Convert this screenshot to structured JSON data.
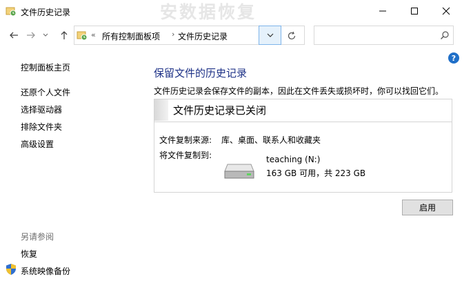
{
  "window": {
    "title": "文件历史记录",
    "watermark": "安数据恢复",
    "minimize_icon": "minimize-icon",
    "maximize_icon": "maximize-icon",
    "close_icon": "close-icon"
  },
  "nav": {
    "back_icon": "back-arrow-icon",
    "forward_icon": "forward-arrow-icon",
    "recent_icon": "chevron-down-icon",
    "up_icon": "up-arrow-icon",
    "address": {
      "overflow": "«",
      "crumbs": [
        "所有控制面板项",
        "文件历史记录"
      ],
      "separator": "›"
    },
    "refresh_icon": "refresh-icon",
    "search": {
      "placeholder": "",
      "icon": "search-icon"
    }
  },
  "sidebar": {
    "items": [
      "控制面板主页",
      "还原个人文件",
      "选择驱动器",
      "排除文件夹",
      "高级设置"
    ],
    "see_also_title": "另请参阅",
    "see_also": [
      "恢复",
      "系统映像备份"
    ]
  },
  "main": {
    "heading": "保留文件的历史记录",
    "description": "文件历史记录会保存文件的副本，因此在文件丢失或损坏时，你可以找回它们。",
    "status_title": "文件历史记录已关闭",
    "copy_from_label": "文件复制来源:",
    "copy_from_value": "库、桌面、联系人和收藏夹",
    "copy_to_label": "将文件复制到:",
    "drive": {
      "name": "teaching (N:)",
      "space": "163 GB 可用，共 223 GB"
    },
    "enable_button": "启用"
  },
  "help": "?",
  "colors": {
    "heading": "#1e3287",
    "accent": "#1f6fc8"
  }
}
